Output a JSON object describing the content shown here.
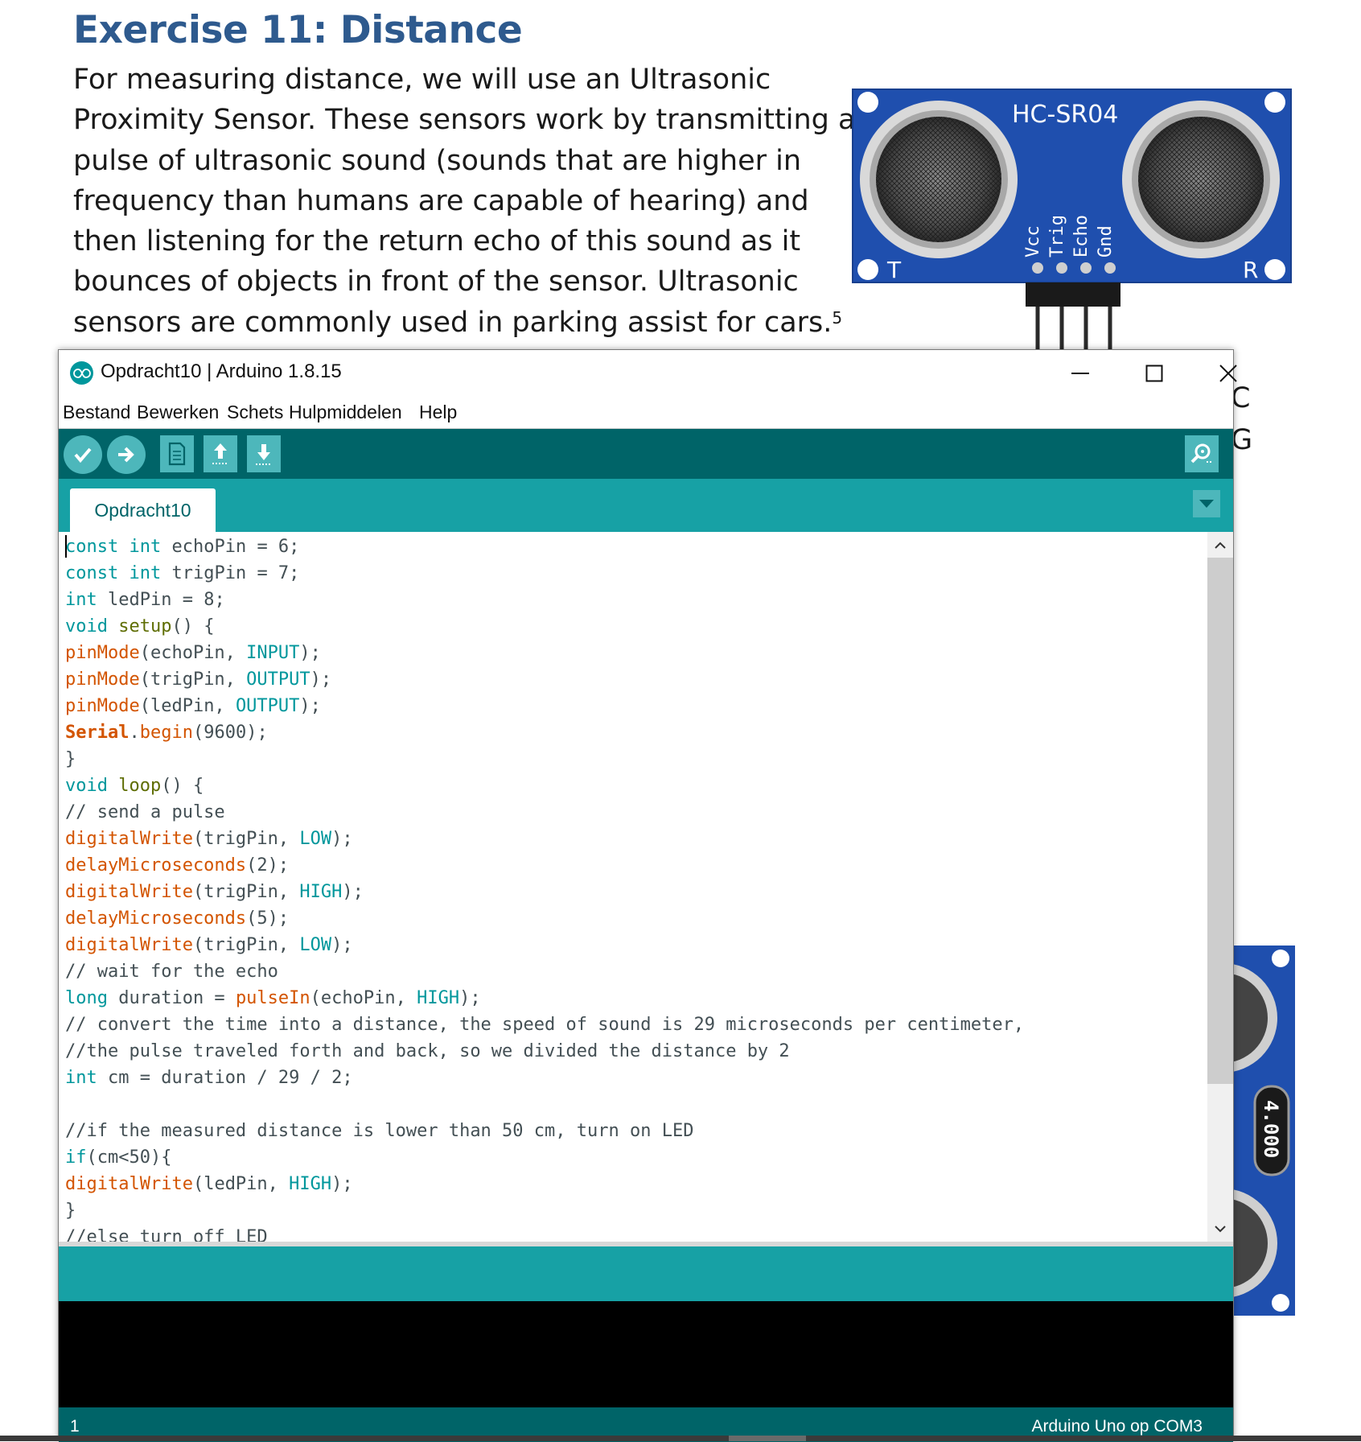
{
  "document": {
    "heading": "Exercise 11: Distance",
    "paragraph_lines": [
      "For measuring distance, we will use an Ultrasonic",
      "Proximity Sensor. These sensors work by transmitting a",
      "pulse of ultrasonic sound (sounds that are higher in",
      "frequency than humans are capable of hearing) and",
      "then listening for the return echo of this sound as it",
      "bounces of objects in front of the sensor. Ultrasonic",
      "sensors are commonly used in parking assist for cars."
    ],
    "footnote": "5",
    "side_text": [
      "C",
      "G"
    ],
    "sensor_labels": {
      "model": "HC-SR04",
      "pins": [
        "Vcc",
        "Trig",
        "Echo",
        "Gnd"
      ],
      "left_mark": "T",
      "right_mark": "R",
      "crystal": "4.000"
    }
  },
  "window": {
    "title": "Opdracht10 | Arduino 1.8.15",
    "menu": [
      "Bestand",
      "Bewerken",
      "Schets",
      "Hulpmiddelen",
      "Help"
    ],
    "toolbar_icons": [
      "verify-icon",
      "upload-icon",
      "new-icon",
      "open-icon",
      "save-icon",
      "serial-monitor-icon"
    ],
    "tab_label": "Opdracht10",
    "status": {
      "line_number": "1",
      "board": "Arduino Uno op COM3"
    },
    "colors": {
      "toolbar": "#006468",
      "tabbar": "#17a1a5",
      "button": "#4db7bb",
      "keyword": "#00979c",
      "function": "#d35400",
      "comment": "#434f54"
    }
  },
  "code_lines": [
    [
      [
        "kw",
        "const"
      ],
      [
        "p",
        " "
      ],
      [
        "kw",
        "int"
      ],
      [
        "p",
        " echoPin = 6;"
      ]
    ],
    [
      [
        "kw",
        "const"
      ],
      [
        "p",
        " "
      ],
      [
        "kw",
        "int"
      ],
      [
        "p",
        " trigPin = 7;"
      ]
    ],
    [
      [
        "kw",
        "int"
      ],
      [
        "p",
        " ledPin = 8;"
      ]
    ],
    [
      [
        "kw",
        "void"
      ],
      [
        "p",
        " "
      ],
      [
        "fn2",
        "setup"
      ],
      [
        "p",
        "() {"
      ]
    ],
    [
      [
        "fn",
        "pinMode"
      ],
      [
        "p",
        "(echoPin, "
      ],
      [
        "kw",
        "INPUT"
      ],
      [
        "p",
        ");"
      ]
    ],
    [
      [
        "fn",
        "pinMode"
      ],
      [
        "p",
        "(trigPin, "
      ],
      [
        "kw",
        "OUTPUT"
      ],
      [
        "p",
        ");"
      ]
    ],
    [
      [
        "fn",
        "pinMode"
      ],
      [
        "p",
        "(ledPin, "
      ],
      [
        "kw",
        "OUTPUT"
      ],
      [
        "p",
        ");"
      ]
    ],
    [
      [
        "fnb",
        "Serial"
      ],
      [
        "p",
        "."
      ],
      [
        "fn",
        "begin"
      ],
      [
        "p",
        "(9600);"
      ]
    ],
    [
      [
        "p",
        "}"
      ]
    ],
    [
      [
        "kw",
        "void"
      ],
      [
        "p",
        " "
      ],
      [
        "fn2",
        "loop"
      ],
      [
        "p",
        "() {"
      ]
    ],
    [
      [
        "cm",
        "// send a pulse"
      ]
    ],
    [
      [
        "fn",
        "digitalWrite"
      ],
      [
        "p",
        "(trigPin, "
      ],
      [
        "kw",
        "LOW"
      ],
      [
        "p",
        ");"
      ]
    ],
    [
      [
        "fn",
        "delayMicroseconds"
      ],
      [
        "p",
        "(2);"
      ]
    ],
    [
      [
        "fn",
        "digitalWrite"
      ],
      [
        "p",
        "(trigPin, "
      ],
      [
        "kw",
        "HIGH"
      ],
      [
        "p",
        ");"
      ]
    ],
    [
      [
        "fn",
        "delayMicroseconds"
      ],
      [
        "p",
        "(5);"
      ]
    ],
    [
      [
        "fn",
        "digitalWrite"
      ],
      [
        "p",
        "(trigPin, "
      ],
      [
        "kw",
        "LOW"
      ],
      [
        "p",
        ");"
      ]
    ],
    [
      [
        "cm",
        "// wait for the echo"
      ]
    ],
    [
      [
        "kw",
        "long"
      ],
      [
        "p",
        " duration = "
      ],
      [
        "fn",
        "pulseIn"
      ],
      [
        "p",
        "(echoPin, "
      ],
      [
        "kw",
        "HIGH"
      ],
      [
        "p",
        ");"
      ]
    ],
    [
      [
        "cm",
        "// convert the time into a distance, the speed of sound is 29 microseconds per centimeter,"
      ]
    ],
    [
      [
        "cm",
        "//the pulse traveled forth and back, so we divided the distance by 2"
      ]
    ],
    [
      [
        "kw",
        "int"
      ],
      [
        "p",
        " cm = duration / 29 / 2;"
      ]
    ],
    [
      [
        "p",
        ""
      ]
    ],
    [
      [
        "cm",
        "//if the measured distance is lower than 50 cm, turn on LED"
      ]
    ],
    [
      [
        "kw",
        "if"
      ],
      [
        "p",
        "(cm<50){"
      ]
    ],
    [
      [
        "fn",
        "digitalWrite"
      ],
      [
        "p",
        "(ledPin, "
      ],
      [
        "kw",
        "HIGH"
      ],
      [
        "p",
        ");"
      ]
    ],
    [
      [
        "p",
        "}"
      ]
    ],
    [
      [
        "cm",
        "//else turn off LED"
      ]
    ]
  ]
}
